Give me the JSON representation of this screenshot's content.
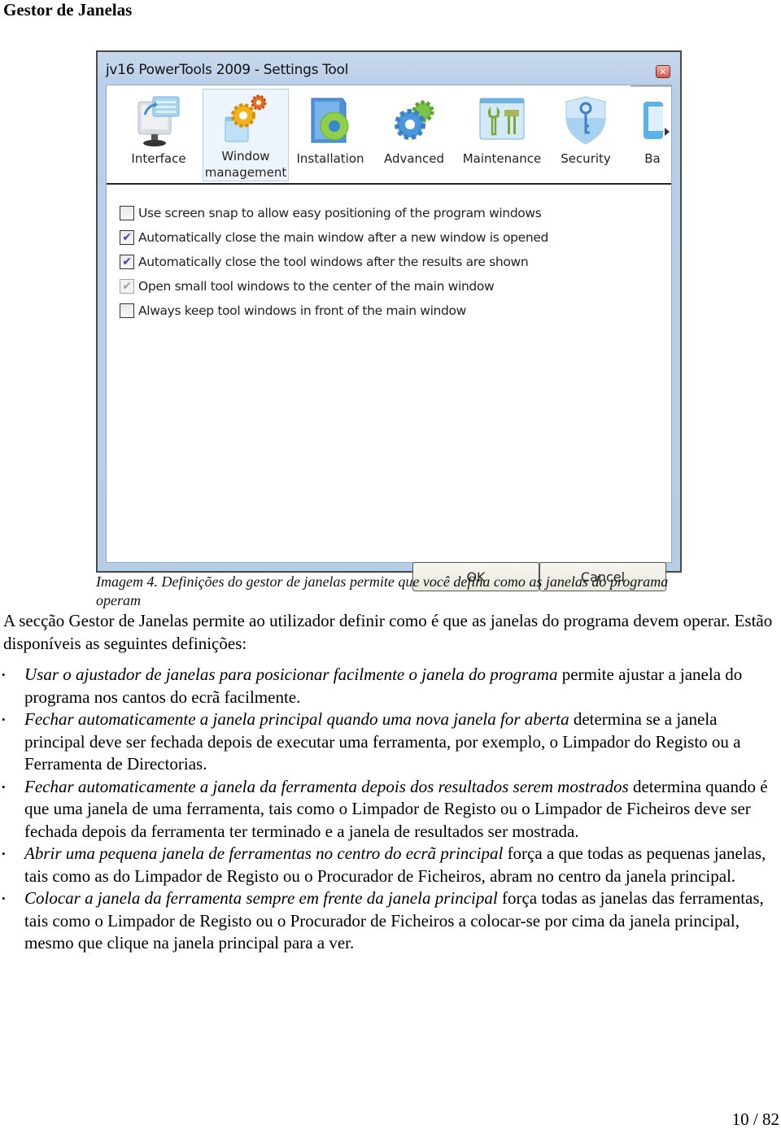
{
  "document": {
    "heading": "Gestor de Janelas",
    "page_number": "10 / 82"
  },
  "window": {
    "title": "jv16 PowerTools 2009 - Settings Tool",
    "close_icon": "close-icon",
    "toolbar": [
      {
        "label": "Interface",
        "icon": "monitor-icon",
        "active": false
      },
      {
        "label": "Window\nmanagement",
        "icon": "gears-window-icon",
        "active": true
      },
      {
        "label": "Installation",
        "icon": "disc-box-icon",
        "active": false
      },
      {
        "label": "Advanced",
        "icon": "gears-icon",
        "active": false
      },
      {
        "label": "Maintenance",
        "icon": "tools-icon",
        "active": false
      },
      {
        "label": "Security",
        "icon": "shield-key-icon",
        "active": false
      },
      {
        "label": "Ba",
        "icon": "backup-icon",
        "active": false
      }
    ],
    "options": [
      {
        "label": "Use screen snap to allow easy positioning of the program windows",
        "checked": false,
        "disabled": false
      },
      {
        "label": "Automatically close the main window after a new window is opened",
        "checked": true,
        "disabled": false
      },
      {
        "label": "Automatically close the tool windows after the results are shown",
        "checked": true,
        "disabled": false
      },
      {
        "label": "Open small tool windows to the center of the main window",
        "checked": true,
        "disabled": true
      },
      {
        "label": "Always keep tool windows in front of the main window",
        "checked": false,
        "disabled": false
      }
    ],
    "buttons": {
      "ok": "OK",
      "cancel": "Cancel"
    }
  },
  "caption": "Imagem 4. Definições do gestor de janelas permite que você defina como as janelas do programa operam",
  "intro": "A secção Gestor de Janelas permite ao utilizador definir como é que as janelas do programa devem operar. Estão disponíveis as seguintes definições:",
  "bullets": [
    {
      "term": "Usar o ajustador de janelas para posicionar facilmente o janela do programa",
      "text": " permite ajustar a janela do programa nos cantos do ecrã facilmente."
    },
    {
      "term": "Fechar automaticamente a janela principal quando uma nova janela for aberta",
      "text": " determina se a janela principal deve ser fechada depois de executar uma ferramenta, por exemplo, o Limpador do Registo ou a Ferramenta de Directorias."
    },
    {
      "term": "Fechar automaticamente a janela da ferramenta depois dos resultados serem mostrados",
      "text": " determina quando é que uma janela de uma ferramenta, tais como o Limpador de Registo ou o Limpador de Ficheiros deve ser fechada depois da ferramenta ter terminado e a janela de resultados ser mostrada."
    },
    {
      "term": "Abrir uma pequena janela de ferramentas no centro do ecrã principal",
      "text": " força a que todas as pequenas janelas, tais como as do Limpador de Registo ou o Procurador de Ficheiros, abram no centro da janela principal."
    },
    {
      "term": "Colocar a janela da ferramenta sempre em frente da janela principal",
      "text": " força todas as janelas das ferramentas, tais como o Limpador de Registo ou o Procurador de Ficheiros a colocar-se por cima da janela principal, mesmo que clique na janela principal para a ver."
    }
  ]
}
